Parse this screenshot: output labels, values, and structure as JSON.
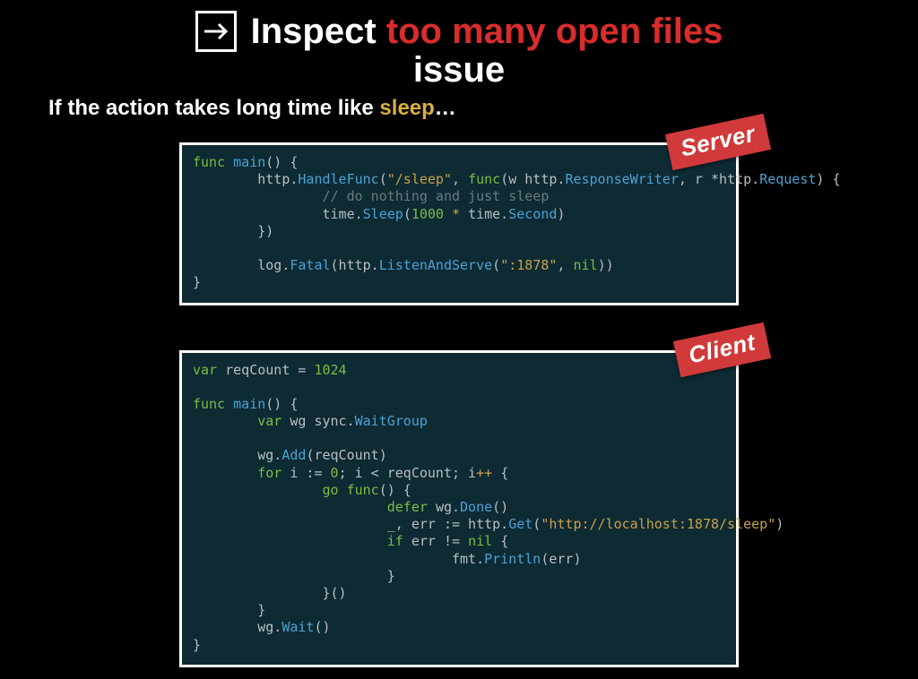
{
  "title": {
    "word_inspect": "Inspect",
    "phrase_red": "too many open files",
    "word_issue": "issue"
  },
  "subtitle": {
    "prefix": "If the action takes long time like ",
    "highlight": "sleep",
    "suffix": "…"
  },
  "badges": {
    "server": "Server",
    "client": "Client"
  },
  "code": {
    "server": [
      {
        "t": "kw",
        "v": "func"
      },
      {
        "t": "sp"
      },
      {
        "t": "fn",
        "v": "main"
      },
      {
        "t": "id",
        "v": "() {"
      },
      {
        "t": "nl"
      },
      {
        "t": "id",
        "v": "        http."
      },
      {
        "t": "fn",
        "v": "HandleFunc"
      },
      {
        "t": "id",
        "v": "("
      },
      {
        "t": "str",
        "v": "\"/sleep\""
      },
      {
        "t": "id",
        "v": ", "
      },
      {
        "t": "kw",
        "v": "func"
      },
      {
        "t": "id",
        "v": "(w http."
      },
      {
        "t": "type",
        "v": "ResponseWriter"
      },
      {
        "t": "id",
        "v": ", r *http."
      },
      {
        "t": "type",
        "v": "Request"
      },
      {
        "t": "id",
        "v": ") {"
      },
      {
        "t": "nl"
      },
      {
        "t": "id",
        "v": "                "
      },
      {
        "t": "cmt",
        "v": "// do nothing and just sleep"
      },
      {
        "t": "nl"
      },
      {
        "t": "id",
        "v": "                time."
      },
      {
        "t": "fn",
        "v": "Sleep"
      },
      {
        "t": "id",
        "v": "("
      },
      {
        "t": "num",
        "v": "1000"
      },
      {
        "t": "sp"
      },
      {
        "t": "op",
        "v": "*"
      },
      {
        "t": "sp"
      },
      {
        "t": "id",
        "v": "time."
      },
      {
        "t": "type",
        "v": "Second"
      },
      {
        "t": "id",
        "v": ")"
      },
      {
        "t": "nl"
      },
      {
        "t": "id",
        "v": "        })"
      },
      {
        "t": "nl"
      },
      {
        "t": "nl"
      },
      {
        "t": "id",
        "v": "        log."
      },
      {
        "t": "fn",
        "v": "Fatal"
      },
      {
        "t": "id",
        "v": "(http."
      },
      {
        "t": "fn",
        "v": "ListenAndServe"
      },
      {
        "t": "id",
        "v": "("
      },
      {
        "t": "str",
        "v": "\":1878\""
      },
      {
        "t": "id",
        "v": ", "
      },
      {
        "t": "num",
        "v": "nil"
      },
      {
        "t": "id",
        "v": "))"
      },
      {
        "t": "nl"
      },
      {
        "t": "id",
        "v": "}"
      }
    ],
    "client": [
      {
        "t": "kw",
        "v": "var"
      },
      {
        "t": "sp"
      },
      {
        "t": "id",
        "v": "reqCount = "
      },
      {
        "t": "num",
        "v": "1024"
      },
      {
        "t": "nl"
      },
      {
        "t": "nl"
      },
      {
        "t": "kw",
        "v": "func"
      },
      {
        "t": "sp"
      },
      {
        "t": "fn",
        "v": "main"
      },
      {
        "t": "id",
        "v": "() {"
      },
      {
        "t": "nl"
      },
      {
        "t": "id",
        "v": "        "
      },
      {
        "t": "kw",
        "v": "var"
      },
      {
        "t": "sp"
      },
      {
        "t": "id",
        "v": "wg sync."
      },
      {
        "t": "type",
        "v": "WaitGroup"
      },
      {
        "t": "nl"
      },
      {
        "t": "nl"
      },
      {
        "t": "id",
        "v": "        wg."
      },
      {
        "t": "fn",
        "v": "Add"
      },
      {
        "t": "id",
        "v": "(reqCount)"
      },
      {
        "t": "nl"
      },
      {
        "t": "id",
        "v": "        "
      },
      {
        "t": "kw",
        "v": "for"
      },
      {
        "t": "sp"
      },
      {
        "t": "id",
        "v": "i := "
      },
      {
        "t": "num",
        "v": "0"
      },
      {
        "t": "id",
        "v": "; i < reqCount; i"
      },
      {
        "t": "op",
        "v": "++"
      },
      {
        "t": "sp"
      },
      {
        "t": "id",
        "v": "{"
      },
      {
        "t": "nl"
      },
      {
        "t": "id",
        "v": "                "
      },
      {
        "t": "kw",
        "v": "go"
      },
      {
        "t": "sp"
      },
      {
        "t": "kw",
        "v": "func"
      },
      {
        "t": "id",
        "v": "() {"
      },
      {
        "t": "nl"
      },
      {
        "t": "id",
        "v": "                        "
      },
      {
        "t": "kw",
        "v": "defer"
      },
      {
        "t": "sp"
      },
      {
        "t": "id",
        "v": "wg."
      },
      {
        "t": "fn",
        "v": "Done"
      },
      {
        "t": "id",
        "v": "()"
      },
      {
        "t": "nl"
      },
      {
        "t": "id",
        "v": "                        _, err := http."
      },
      {
        "t": "fn",
        "v": "Get"
      },
      {
        "t": "id",
        "v": "("
      },
      {
        "t": "str",
        "v": "\"http://localhost:1878/sleep\""
      },
      {
        "t": "id",
        "v": ")"
      },
      {
        "t": "nl"
      },
      {
        "t": "id",
        "v": "                        "
      },
      {
        "t": "kw",
        "v": "if"
      },
      {
        "t": "sp"
      },
      {
        "t": "id",
        "v": "err != "
      },
      {
        "t": "num",
        "v": "nil"
      },
      {
        "t": "sp"
      },
      {
        "t": "id",
        "v": "{"
      },
      {
        "t": "nl"
      },
      {
        "t": "id",
        "v": "                                fmt."
      },
      {
        "t": "fn",
        "v": "Println"
      },
      {
        "t": "id",
        "v": "(err)"
      },
      {
        "t": "nl"
      },
      {
        "t": "id",
        "v": "                        }"
      },
      {
        "t": "nl"
      },
      {
        "t": "id",
        "v": "                }()"
      },
      {
        "t": "nl"
      },
      {
        "t": "id",
        "v": "        }"
      },
      {
        "t": "nl"
      },
      {
        "t": "id",
        "v": "        wg."
      },
      {
        "t": "fn",
        "v": "Wait"
      },
      {
        "t": "id",
        "v": "()"
      },
      {
        "t": "nl"
      },
      {
        "t": "id",
        "v": "}"
      }
    ]
  }
}
